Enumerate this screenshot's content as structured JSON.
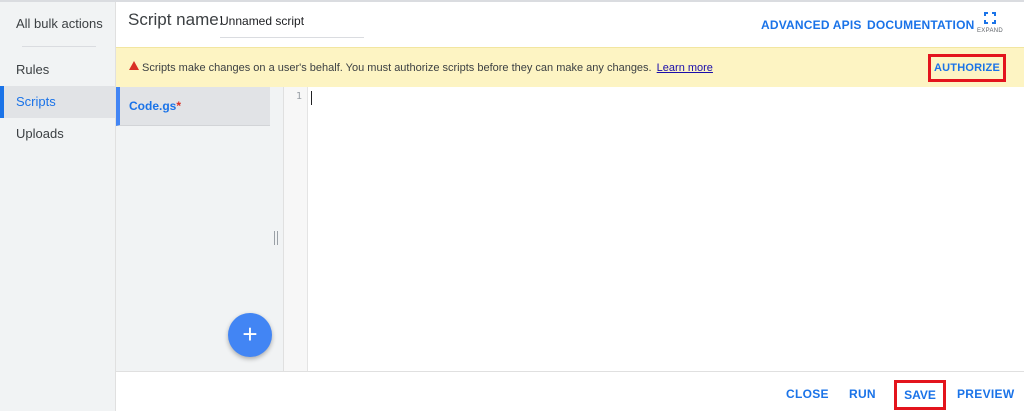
{
  "sidebar": {
    "header": "All bulk actions",
    "items": [
      {
        "label": "Rules",
        "active": false
      },
      {
        "label": "Scripts",
        "active": true
      },
      {
        "label": "Uploads",
        "active": false
      }
    ]
  },
  "header": {
    "script_name_label": "Script name:",
    "script_name_value": "Unnamed script",
    "advanced_apis": "ADVANCED APIS",
    "documentation": "DOCUMENTATION",
    "expand": "EXPAND",
    "expand_icon": "fullscreen-icon"
  },
  "warning": {
    "icon": "warning-icon",
    "message": "Scripts make changes on a user's behalf. You must authorize scripts before they can make any changes.",
    "link": "Learn more",
    "authorize": "AUTHORIZE"
  },
  "files": {
    "items": [
      {
        "name": "Code.gs",
        "modified_mark": "*"
      }
    ],
    "add_icon": "plus-icon",
    "add_label": "+"
  },
  "editor": {
    "line_numbers": [
      "1"
    ],
    "content": ""
  },
  "footer": {
    "close": "CLOSE",
    "run": "RUN",
    "save": "SAVE",
    "preview": "PREVIEW"
  },
  "colors": {
    "accent": "#1a73e8",
    "warning_bg": "#fdf4c3",
    "highlight_box": "#e3141d",
    "fab": "#4285f4"
  }
}
